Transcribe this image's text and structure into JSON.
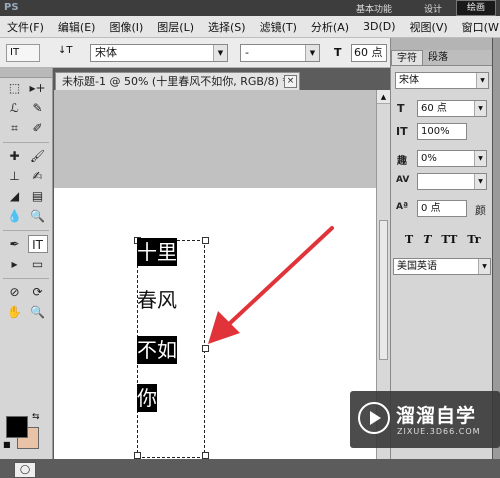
{
  "topstrip": {
    "app": "PS",
    "workspace_basic": "基本功能",
    "workspace_design": "设计",
    "workspace_selected": "绘画"
  },
  "menu": [
    "文件(F)",
    "编辑(E)",
    "图像(I)",
    "图层(L)",
    "选择(S)",
    "滤镜(T)",
    "分析(A)",
    "3D(D)",
    "视图(V)",
    "窗口(W)"
  ],
  "options": {
    "tool_label": "IT",
    "orient_label": "↓T",
    "font_family": "宋体",
    "font_style": "-",
    "size_icon": "T",
    "font_size": "60 点"
  },
  "tools": [
    [
      "⬚",
      "▸+"
    ],
    [
      "ℒ",
      "✎"
    ],
    [
      "⌗",
      "✐"
    ],
    [
      "✚",
      "🖌"
    ],
    [
      "⊥",
      "✍"
    ],
    [
      "◢",
      "▤"
    ],
    [
      "💧",
      "🔍"
    ],
    [
      "✒",
      "IT"
    ],
    [
      "▸",
      "▭"
    ],
    [
      "⊘",
      "⟳"
    ],
    [
      "✋",
      "🔍"
    ]
  ],
  "document": {
    "tab_title": "未标题-1 @ 50% (十里春风不如你, RGB/8) *",
    "close_label": "×",
    "lines": [
      "十里",
      "春风",
      "不如",
      "你"
    ]
  },
  "panel": {
    "tab_char": "字符",
    "tab_para": "段落",
    "font_family": "宋体",
    "font_size": "60 点",
    "vscale": "100%",
    "tracking": "0%",
    "kerning": "",
    "baseline": "0 点",
    "color_label": "颜",
    "styles": [
      "T",
      "T",
      "TT",
      "Tr"
    ],
    "language": "美国英语",
    "icon_size": "T",
    "icon_vscale": "IT",
    "icon_tracking": "趣",
    "icon_kerning": "AV",
    "icon_baseline": "Aª"
  },
  "watermark": {
    "title": "溜溜自学",
    "url": "ZIXUE.3D66.COM"
  },
  "colors": {
    "foreground": "#000000",
    "background": "#e8c3a8",
    "arrow": "#e0333a"
  }
}
